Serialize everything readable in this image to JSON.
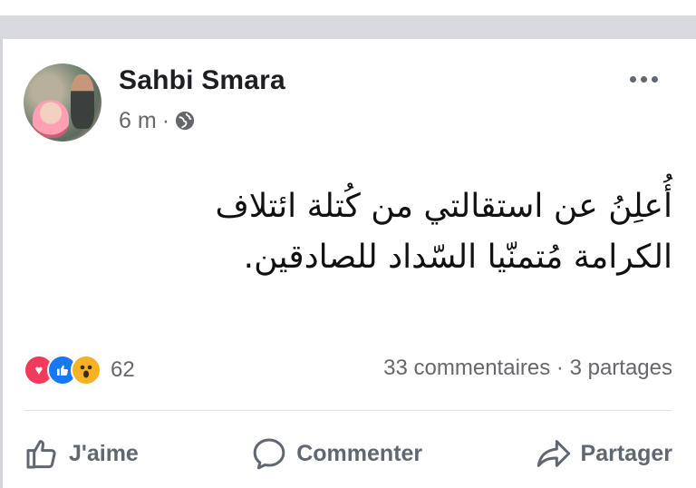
{
  "post": {
    "author": "Sahbi Smara",
    "time": "6 m",
    "separator": "·",
    "privacy_icon": "globe-icon",
    "more_icon": "more-options-icon",
    "text_line1": "أُعلِنُ عن استقالتي من كُتلة ائتلاف",
    "text_line2": "الكرامة مُتمنّيا السّداد للصادقين."
  },
  "reactions": {
    "icons": [
      "love-icon",
      "like-icon",
      "wow-icon"
    ],
    "count": "62",
    "colors": {
      "love": "#f23b5a",
      "like": "#1877f2",
      "wow": "#f7b125"
    }
  },
  "stats": {
    "comments": "33 commentaires",
    "dot": "·",
    "shares": "3 partages"
  },
  "actions": {
    "like": "J'aime",
    "comment": "Commenter",
    "share": "Partager"
  }
}
